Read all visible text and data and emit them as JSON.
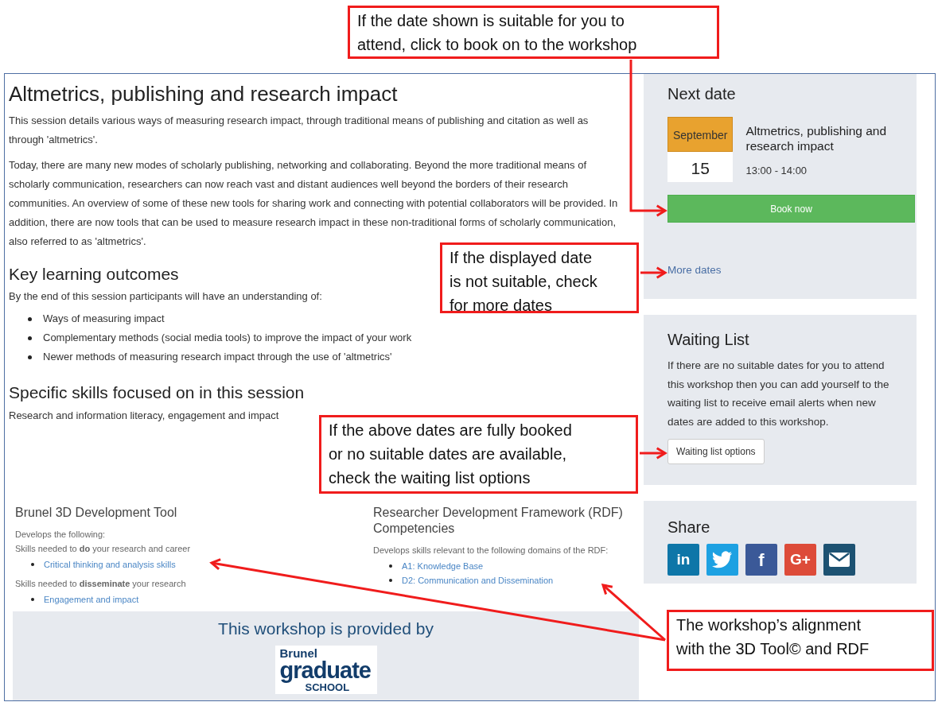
{
  "article": {
    "title": "Altmetrics, publishing and research impact",
    "paragraphs": [
      "This session details various ways of measuring research impact, through traditional means of publishing and citation as well as through 'altmetrics'.",
      "Today, there are many new modes of scholarly publishing, networking and collaborating. Beyond the more traditional means of scholarly communication, researchers can now reach vast and distant audiences well beyond the borders of their research communities. An overview of some of these new tools for sharing work and connecting with potential collaborators will be provided. In addition, there are now tools that can be used to measure research impact in these non-traditional forms of scholarly communication, also referred to as 'altmetrics'."
    ],
    "outcomes": {
      "heading": "Key learning outcomes",
      "intro": "By the end of this session participants will have an understanding of:",
      "bullets": [
        "Ways of measuring impact",
        "Complementary methods (social media tools) to improve the impact of your work",
        "Newer methods of measuring research impact through the use of 'altmetrics'"
      ]
    },
    "skills": {
      "heading": "Specific skills focused on in this session",
      "text": "Research and information literacy, engagement and impact"
    }
  },
  "frameworks": [
    {
      "heading": "Brunel 3D Development Tool",
      "groups": [
        {
          "lines": [
            "Develops the following:",
            "Skills needed to **do** your research and career"
          ],
          "links": [
            "Critical thinking and analysis skills"
          ]
        },
        {
          "lines": [
            "Skills needed to **disseminate** your research"
          ],
          "links": [
            "Engagement and impact"
          ]
        }
      ]
    },
    {
      "heading": "Researcher Development Framework (RDF) Competencies",
      "groups": [
        {
          "lines": [
            "Develops skills relevant to the following domains of the RDF:"
          ],
          "links": [
            "A1: Knowledge Base",
            "D2: Communication and Dissemination"
          ]
        }
      ]
    }
  ],
  "provider": {
    "text": "This workshop is provided by",
    "logo": [
      "Brunel",
      "graduate",
      "SCHOOL"
    ]
  },
  "sidebar": {
    "next_date": {
      "heading": "Next date",
      "month": "September",
      "day": "15",
      "title": "Altmetrics, publishing and research impact",
      "time": "13:00 - 14:00",
      "book": "Book now",
      "more": "More dates"
    },
    "waiting_list": {
      "heading": "Waiting List",
      "text": "If there are no suitable dates for you to attend this workshop then you can add yourself to the waiting list to receive email alerts when new dates are added to this workshop.",
      "button": "Waiting list options"
    },
    "share": {
      "heading": "Share",
      "buttons": [
        {
          "kind": "text",
          "label": "in",
          "color": "#0e76a8"
        },
        {
          "kind": "bird",
          "color": "#1da1e2"
        },
        {
          "kind": "text",
          "label": "f",
          "color": "#3b5998"
        },
        {
          "kind": "text",
          "label": "G+",
          "color": "#dd4b39"
        },
        {
          "kind": "mail",
          "color": "#1d5272"
        }
      ]
    }
  },
  "callouts": [
    {
      "lines": [
        "If the date shown is suitable for you to",
        "attend, click to book on to the workshop"
      ]
    },
    {
      "lines": [
        "If the displayed date",
        "is not suitable, check",
        "for more dates"
      ]
    },
    {
      "lines": [
        "If the above dates are fully booked",
        "or no suitable dates are available,",
        "check the waiting list options"
      ]
    },
    {
      "lines": [
        "The workshop’s alignment",
        "with the 3D Tool© and RDF"
      ]
    }
  ]
}
